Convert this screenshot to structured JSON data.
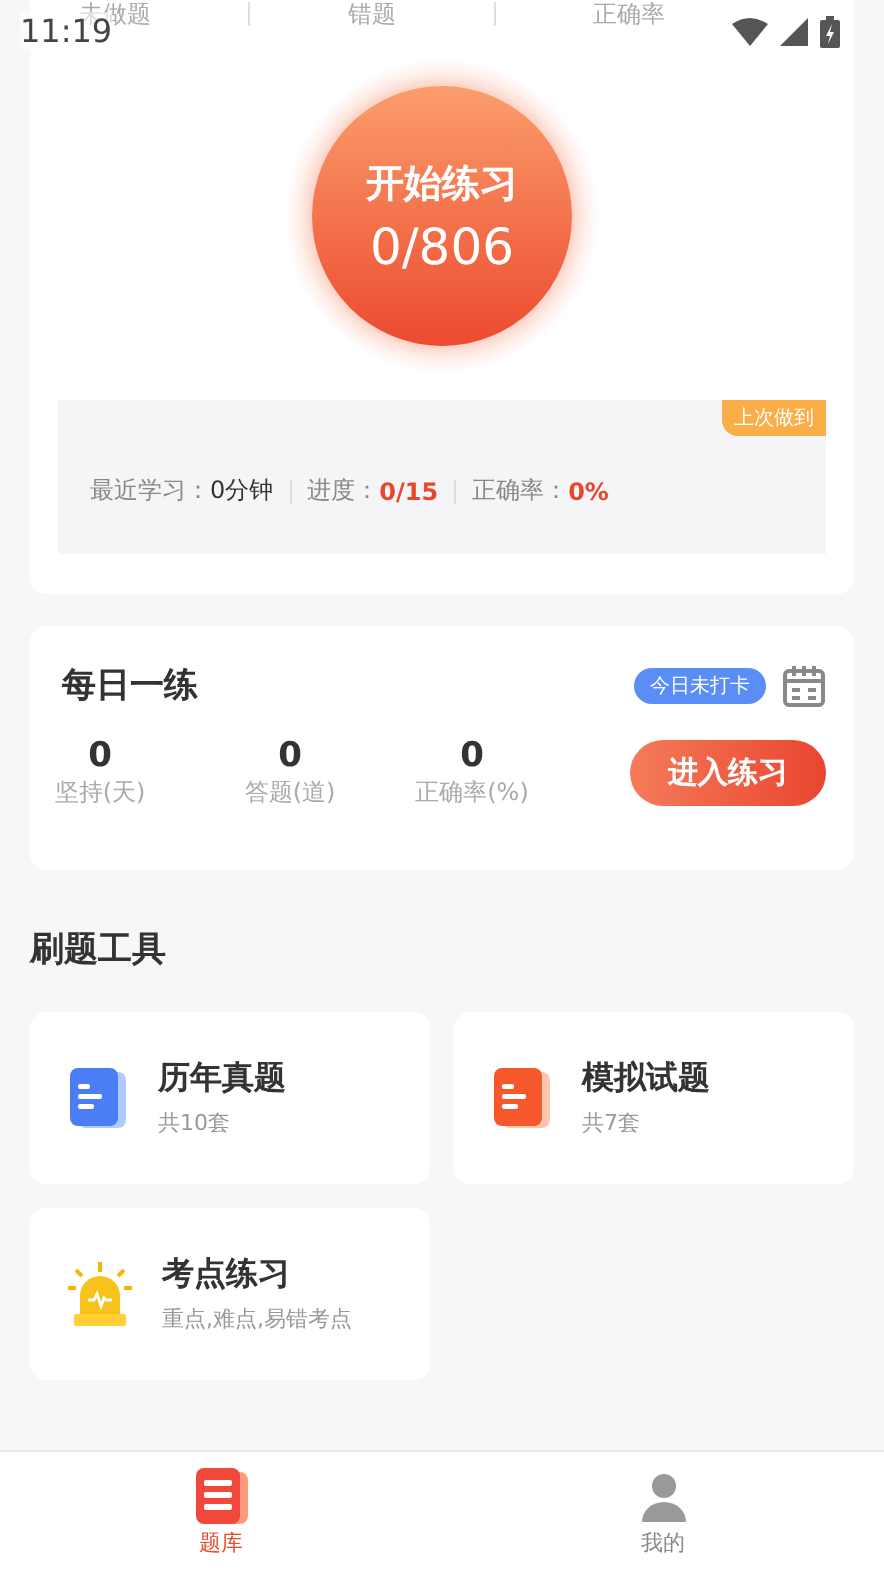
{
  "header_stats": [
    {
      "label": "未做题"
    },
    {
      "label": "错题"
    },
    {
      "label": "正确率"
    }
  ],
  "status_bar": {
    "time": "11:19"
  },
  "practice": {
    "title": "开始练习",
    "progress": "0/806"
  },
  "last_session": {
    "badge": "上次做到",
    "items": [
      {
        "label": "最近学习：",
        "value": "0分钟",
        "kind": "plain"
      },
      {
        "label": "进度：",
        "value": "0/15",
        "kind": "highlight"
      },
      {
        "label": "正确率：",
        "value": "0%",
        "kind": "highlight"
      }
    ]
  },
  "daily": {
    "title": "每日一练",
    "badge": "今日未打卡",
    "stats": [
      {
        "value": "0",
        "label": "坚持(天)"
      },
      {
        "value": "0",
        "label": "答题(道)"
      },
      {
        "value": "0",
        "label": "正确率(%)"
      }
    ],
    "button": "进入练习"
  },
  "tools": {
    "title": "刷题工具",
    "items": [
      {
        "kind": "doc-blue",
        "title": "历年真题",
        "subtitle": "共10套"
      },
      {
        "kind": "doc-orange",
        "title": "模拟试题",
        "subtitle": "共7套"
      },
      {
        "kind": "alarm",
        "title": "考点练习",
        "subtitle": "重点,难点,易错考点"
      }
    ]
  },
  "tab_bar": [
    {
      "label": "题库",
      "selected": true,
      "kind": "list"
    },
    {
      "label": "我的",
      "selected": false,
      "kind": "person"
    }
  ]
}
